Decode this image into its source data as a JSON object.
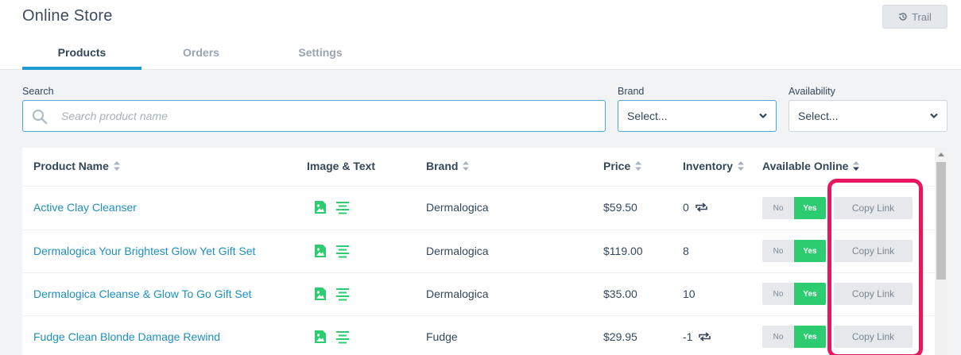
{
  "app": {
    "title": "Online Store",
    "trail_label": "Trail"
  },
  "tabs": [
    {
      "label": "Products",
      "active": true
    },
    {
      "label": "Orders",
      "active": false
    },
    {
      "label": "Settings",
      "active": false
    }
  ],
  "filters": {
    "search_label": "Search",
    "search_placeholder": "Search product name",
    "search_value": "",
    "brand_label": "Brand",
    "brand_value": "Select...",
    "availability_label": "Availability",
    "availability_value": "Select..."
  },
  "table": {
    "columns": [
      "Product Name",
      "Image & Text",
      "Brand",
      "Price",
      "Inventory",
      "Available Online"
    ],
    "rows": [
      {
        "name": "Active Clay Cleanser",
        "brand": "Dermalogica",
        "price": "$59.50",
        "inventory": "0",
        "synced": true,
        "toggle_no": "No",
        "toggle_yes": "Yes",
        "copy": "Copy Link"
      },
      {
        "name": "Dermalogica Your Brightest Glow Yet Gift Set",
        "brand": "Dermalogica",
        "price": "$119.00",
        "inventory": "8",
        "synced": false,
        "toggle_no": "No",
        "toggle_yes": "Yes",
        "copy": "Copy Link"
      },
      {
        "name": "Dermalogica Cleanse & Glow To Go Gift Set",
        "brand": "Dermalogica",
        "price": "$35.00",
        "inventory": "10",
        "synced": false,
        "toggle_no": "No",
        "toggle_yes": "Yes",
        "copy": "Copy Link"
      },
      {
        "name": "Fudge Clean Blonde Damage Rewind",
        "brand": "Fudge",
        "price": "$29.95",
        "inventory": "-1",
        "synced": true,
        "toggle_no": "No",
        "toggle_yes": "Yes",
        "copy": "Copy Link"
      }
    ]
  },
  "colors": {
    "accent": "#1f9bcf",
    "link": "#1e8fc0",
    "yes_green": "#2ecc71",
    "highlight": "#e8155f"
  },
  "icons": [
    "history-icon",
    "search-icon",
    "chevron-down-icon",
    "image-file-icon",
    "align-center-icon",
    "sync-icon",
    "sort-icon"
  ]
}
